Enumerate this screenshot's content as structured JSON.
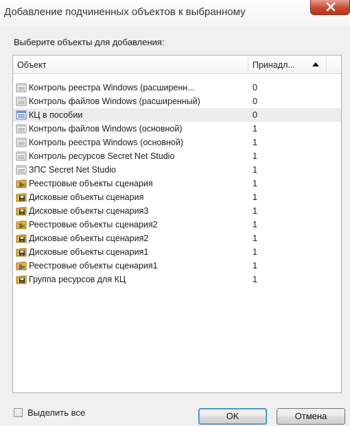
{
  "window": {
    "title": "Добавление подчиненных объектов к выбранному"
  },
  "prompt": "Выберите объекты для добавления:",
  "list": {
    "columns": {
      "name": "Объект",
      "owner": "Принадл..."
    },
    "sort": "ascending",
    "rows": [
      {
        "name": "Контроль реестра Windows (расширенн...",
        "value": "0",
        "icon": "document-list-icon"
      },
      {
        "name": "Контроль файлов Windows (расширенный)",
        "value": "0",
        "icon": "document-list-icon"
      },
      {
        "name": "КЦ в пособии",
        "value": "0",
        "icon": "document-list-blue-icon",
        "selected": true
      },
      {
        "name": "Контроль файлов Windows (основной)",
        "value": "1",
        "icon": "document-list-icon"
      },
      {
        "name": "Контроль реестра Windows (основной)",
        "value": "1",
        "icon": "document-list-icon"
      },
      {
        "name": "Контроль ресурсов Secret Net Studio",
        "value": "1",
        "icon": "document-list-icon"
      },
      {
        "name": "ЗПС Secret Net Studio",
        "value": "1",
        "icon": "document-list-icon"
      },
      {
        "name": "Реестровые объекты сценария",
        "value": "1",
        "icon": "registry-folder-icon"
      },
      {
        "name": "Дисковые объекты сценария",
        "value": "1",
        "icon": "disk-folder-icon"
      },
      {
        "name": "Дисковые объекты сценария3",
        "value": "1",
        "icon": "disk-folder-icon"
      },
      {
        "name": "Реестровые объекты сценария2",
        "value": "1",
        "icon": "registry-folder-icon"
      },
      {
        "name": "Дисковые объекты сценария2",
        "value": "1",
        "icon": "disk-folder-icon"
      },
      {
        "name": "Дисковые объекты сценария1",
        "value": "1",
        "icon": "disk-folder-icon"
      },
      {
        "name": "Реестровые объекты сценария1",
        "value": "1",
        "icon": "registry-folder-icon"
      },
      {
        "name": "Группа ресурсов для КЦ",
        "value": "1",
        "icon": "disk-folder-icon"
      }
    ]
  },
  "select_all": {
    "label": "Выделить все",
    "checked": false
  },
  "buttons": {
    "ok": "OK",
    "cancel": "Отмена"
  },
  "colors": {
    "close_button": "#c84a33",
    "selected_row": "#ededed",
    "default_button_border": "#3c7fb1"
  }
}
